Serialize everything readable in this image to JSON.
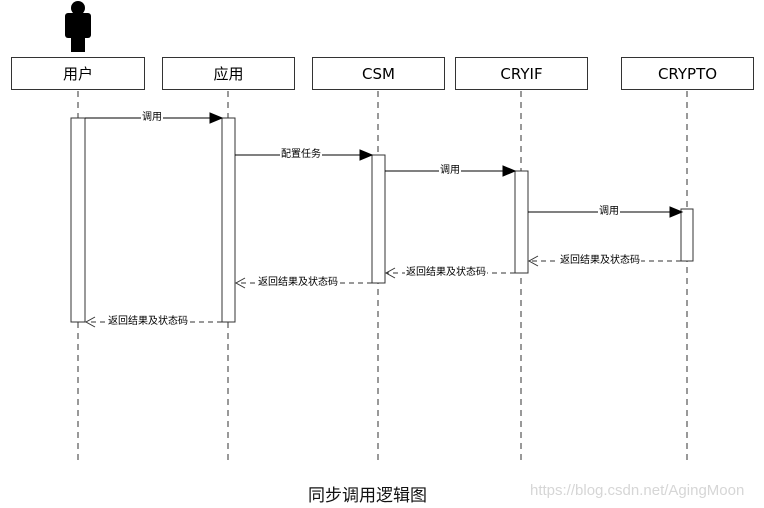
{
  "participants": [
    {
      "id": "user",
      "label": "用户",
      "actor_icon": "person-icon"
    },
    {
      "id": "app",
      "label": "应用"
    },
    {
      "id": "csm",
      "label": "CSM"
    },
    {
      "id": "cryif",
      "label": "CRYIF"
    },
    {
      "id": "crypto",
      "label": "CRYPTO"
    }
  ],
  "messages": [
    {
      "from": "user",
      "to": "app",
      "label": "调用",
      "type": "sync"
    },
    {
      "from": "app",
      "to": "csm",
      "label": "配置任务",
      "type": "sync"
    },
    {
      "from": "csm",
      "to": "cryif",
      "label": "调用",
      "type": "sync"
    },
    {
      "from": "cryif",
      "to": "crypto",
      "label": "调用",
      "type": "sync"
    },
    {
      "from": "crypto",
      "to": "cryif",
      "label": "返回结果及状态码",
      "type": "return"
    },
    {
      "from": "cryif",
      "to": "csm",
      "label": "返回结果及状态码",
      "type": "return"
    },
    {
      "from": "csm",
      "to": "app",
      "label": "返回结果及状态码",
      "type": "return"
    },
    {
      "from": "app",
      "to": "user",
      "label": "返回结果及状态码",
      "type": "return"
    }
  ],
  "caption": "同步调用逻辑图",
  "watermark": "https://blog.csdn.net/AgingMoon"
}
